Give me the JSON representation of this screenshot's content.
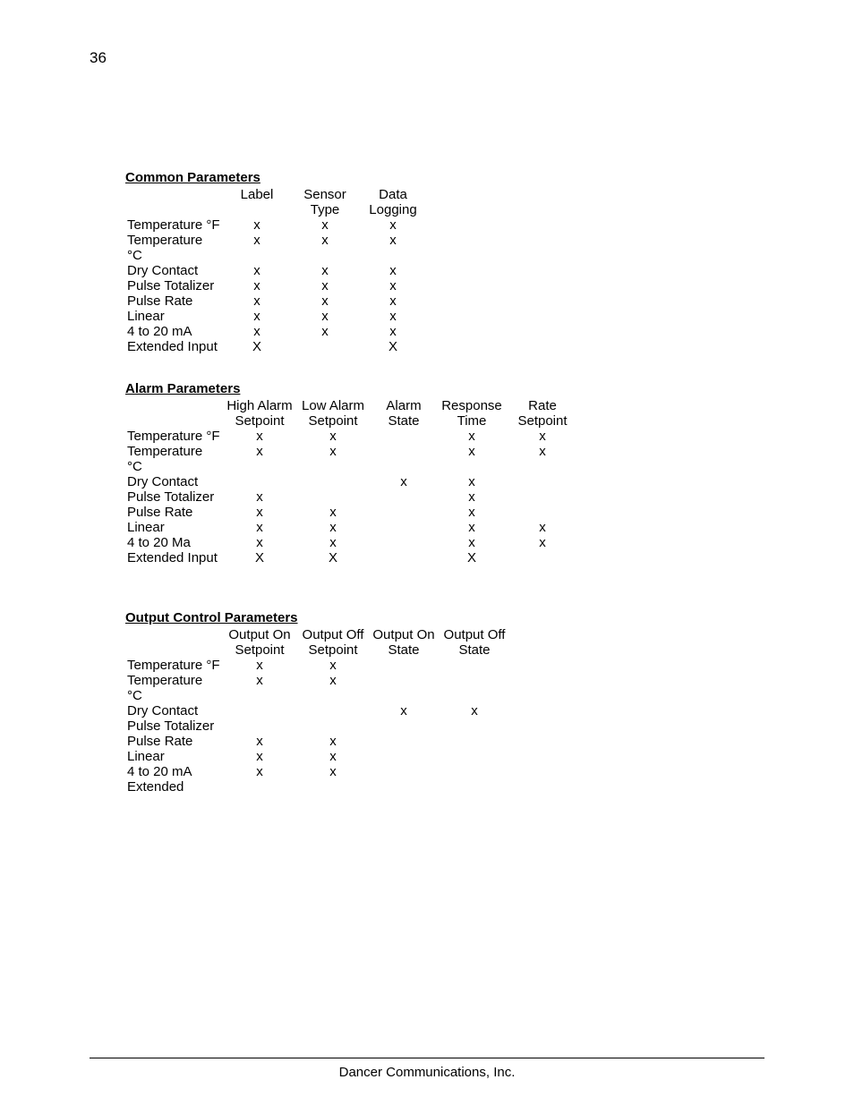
{
  "page_number": "36",
  "footer": "Dancer Communications, Inc.",
  "sections": {
    "common": {
      "title": "Common Parameters",
      "headers": [
        "Label",
        "Sensor Type",
        "Data Logging"
      ],
      "rows": [
        {
          "label": "Temperature °F",
          "c1": "x",
          "c2": "x",
          "c3": "x"
        },
        {
          "label": "Temperature °C",
          "c1": "x",
          "c2": "x",
          "c3": "x"
        },
        {
          "label": "Dry Contact",
          "c1": "x",
          "c2": "x",
          "c3": "x"
        },
        {
          "label": "Pulse Totalizer",
          "c1": "x",
          "c2": "x",
          "c3": "x"
        },
        {
          "label": "Pulse Rate",
          "c1": "x",
          "c2": "x",
          "c3": "x"
        },
        {
          "label": "Linear",
          "c1": "x",
          "c2": "x",
          "c3": "x"
        },
        {
          "label": "4 to 20 mA",
          "c1": "x",
          "c2": "x",
          "c3": "x"
        },
        {
          "label": "Extended Input",
          "c1": "X",
          "c2": "",
          "c3": "X"
        }
      ]
    },
    "alarm": {
      "title": "Alarm Parameters",
      "headers": [
        "High Alarm Setpoint",
        "Low Alarm Setpoint",
        "Alarm State",
        "Response Time",
        "Rate Setpoint"
      ],
      "rows": [
        {
          "label": "Temperature °F",
          "c1": "x",
          "c2": "x",
          "c3": "",
          "c4": "x",
          "c5": "x"
        },
        {
          "label": "Temperature °C",
          "c1": "x",
          "c2": "x",
          "c3": "",
          "c4": "x",
          "c5": "x"
        },
        {
          "label": "Dry Contact",
          "c1": "",
          "c2": "",
          "c3": "x",
          "c4": "x",
          "c5": ""
        },
        {
          "label": "Pulse Totalizer",
          "c1": "x",
          "c2": "",
          "c3": "",
          "c4": "x",
          "c5": ""
        },
        {
          "label": "Pulse Rate",
          "c1": "x",
          "c2": "x",
          "c3": "",
          "c4": "x",
          "c5": ""
        },
        {
          "label": "Linear",
          "c1": "x",
          "c2": "x",
          "c3": "",
          "c4": "x",
          "c5": "x"
        },
        {
          "label": "4 to 20 Ma",
          "c1": "x",
          "c2": "x",
          "c3": "",
          "c4": "x",
          "c5": "x"
        },
        {
          "label": "Extended Input",
          "c1": "X",
          "c2": "X",
          "c3": "",
          "c4": "X",
          "c5": ""
        }
      ]
    },
    "output": {
      "title": "Output Control Parameters",
      "headers": [
        "Output On Setpoint",
        "Output Off Setpoint",
        "Output On State",
        "Output Off State"
      ],
      "rows": [
        {
          "label": "Temperature °F",
          "c1": "x",
          "c2": "x",
          "c3": "",
          "c4": ""
        },
        {
          "label": "Temperature °C",
          "c1": "x",
          "c2": "x",
          "c3": "",
          "c4": ""
        },
        {
          "label": "Dry Contact",
          "c1": "",
          "c2": "",
          "c3": "x",
          "c4": "x"
        },
        {
          "label": "Pulse Totalizer",
          "c1": "",
          "c2": "",
          "c3": "",
          "c4": ""
        },
        {
          "label": "Pulse Rate",
          "c1": "x",
          "c2": "x",
          "c3": "",
          "c4": ""
        },
        {
          "label": "Linear",
          "c1": "x",
          "c2": "x",
          "c3": "",
          "c4": ""
        },
        {
          "label": "4 to 20 mA",
          "c1": "x",
          "c2": "x",
          "c3": "",
          "c4": ""
        },
        {
          "label": "Extended",
          "c1": "",
          "c2": "",
          "c3": "",
          "c4": ""
        }
      ]
    }
  }
}
